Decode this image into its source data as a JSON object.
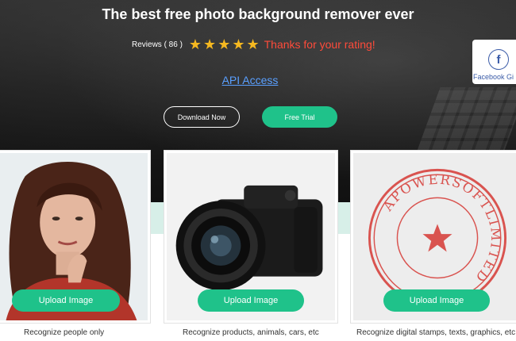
{
  "hero": {
    "title": "The best free photo background remover ever",
    "reviews_label": "Reviews ( 86 )",
    "stars": [
      "★",
      "★",
      "★",
      "★",
      "★"
    ],
    "thanks": "Thanks for your rating!",
    "api_link": "API Access",
    "download_label": "Download Now",
    "trial_label": "Free Trial"
  },
  "facebook": {
    "icon": "f",
    "label": "Facebook Gi"
  },
  "cards": [
    {
      "upload_label": "Upload Image",
      "caption": "Recognize people only"
    },
    {
      "upload_label": "Upload Image",
      "caption": "Recognize products, animals, cars, etc"
    },
    {
      "upload_label": "Upload Image",
      "caption": "Recognize digital stamps, texts, graphics, etc"
    }
  ],
  "stamp": {
    "ring_text": "APOWERSOFTLIMITED"
  },
  "colors": {
    "accent": "#1fc28a",
    "star": "#f5b820",
    "thanks": "#ff4b3a",
    "link": "#5aa0ff",
    "stamp": "#d9534f"
  }
}
